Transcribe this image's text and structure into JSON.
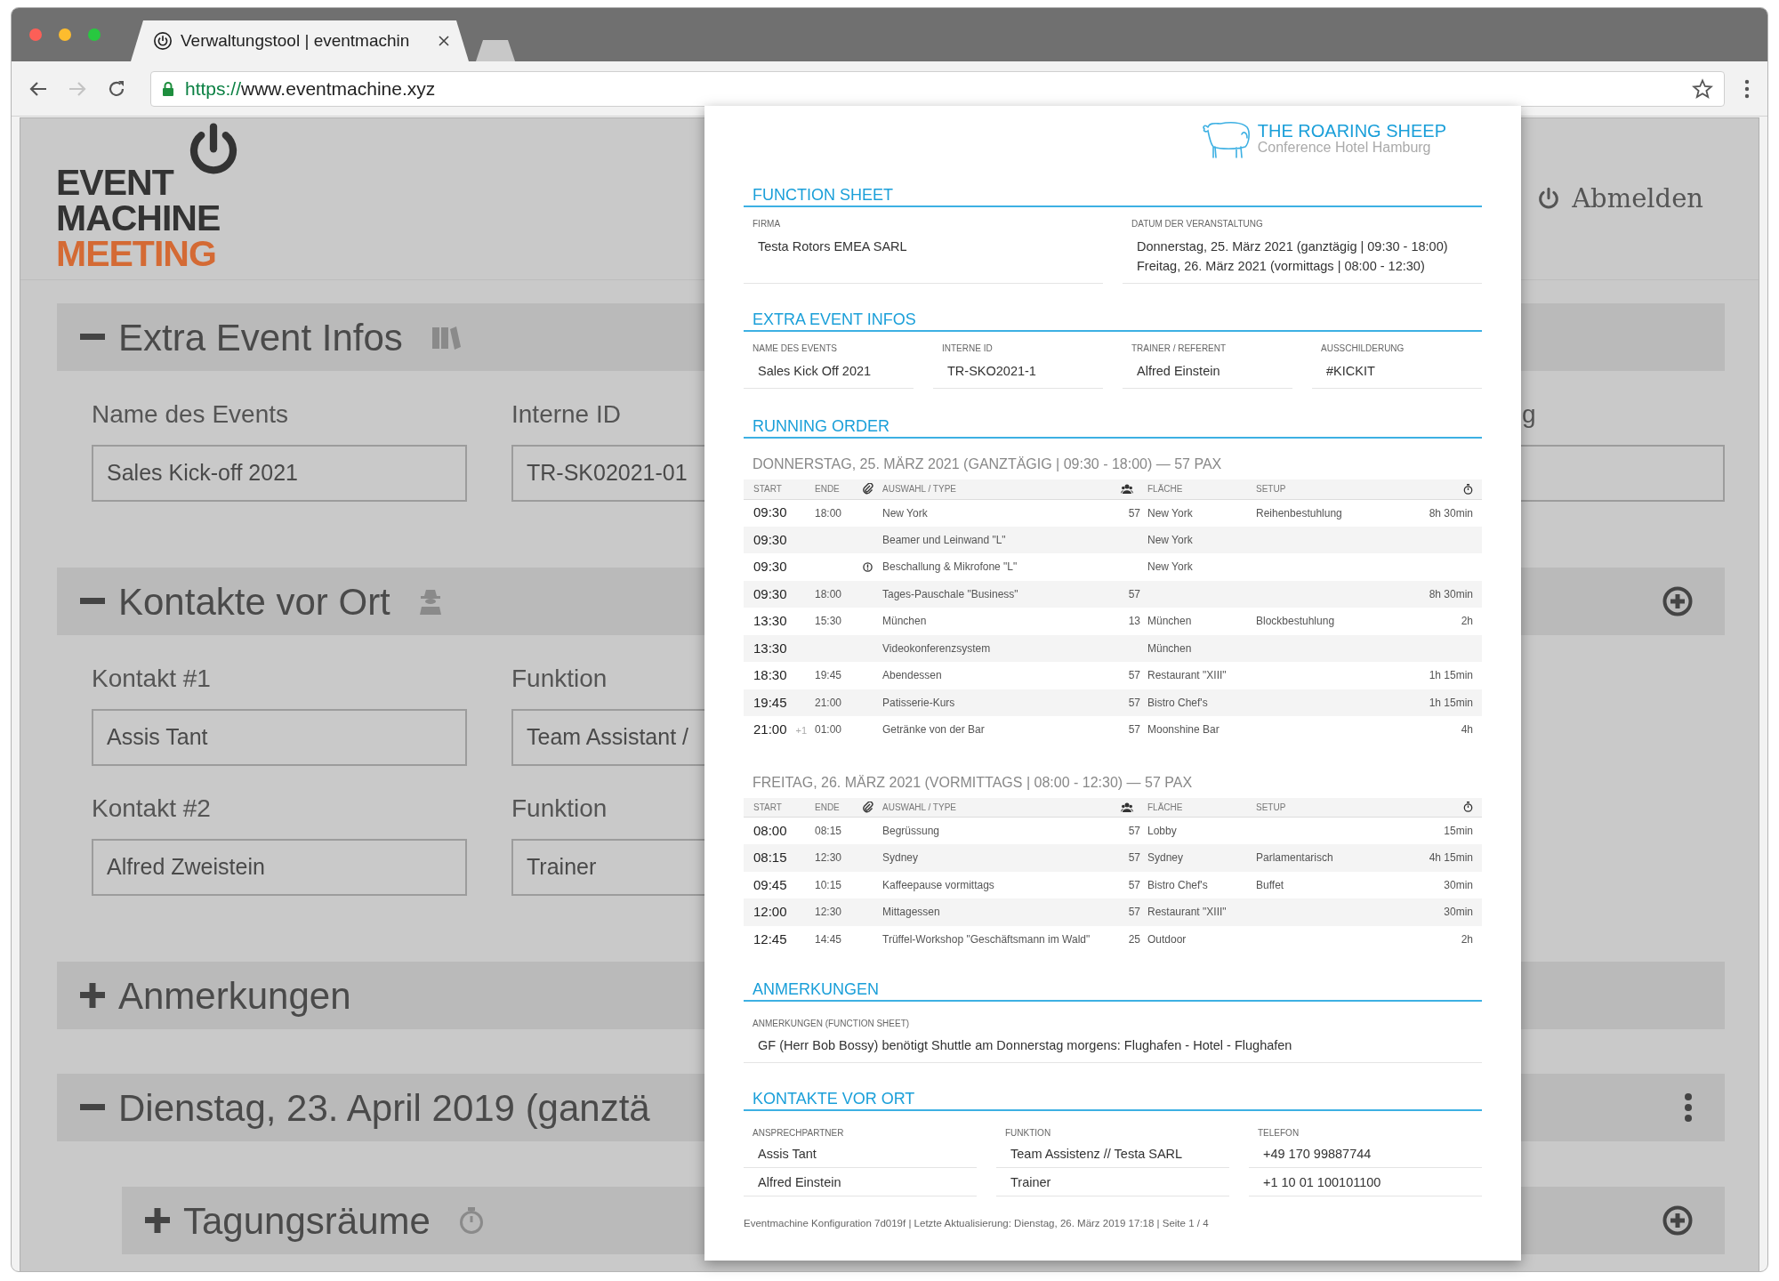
{
  "browser": {
    "tab_title": "Verwaltungstool | eventmachin",
    "url_scheme": "https://",
    "url_host": "www.eventmachine.xyz",
    "forward_disabled": true
  },
  "app": {
    "logo": [
      "EVENT",
      "MACHINE",
      "MEETING"
    ],
    "logout": "Abmelden",
    "sections": [
      {
        "title": "Extra Event Infos",
        "kind": "plain",
        "expanded": true,
        "rows": [
          [
            {
              "label": "Name des Events",
              "value": "Sales Kick-off 2021"
            },
            {
              "label": "Interne ID",
              "value": "TR-SK02021-01"
            }
          ]
        ],
        "side_field": {
          "label": "g"
        }
      },
      {
        "title": "Kontakte vor Ort",
        "expanded": true,
        "kind": "add",
        "rows": [
          [
            {
              "label": "Kontakt #1",
              "value": "Assis Tant"
            },
            {
              "label": "Funktion",
              "value": "Team Assistant /"
            }
          ],
          [
            {
              "label": "Kontakt #2",
              "value": "Alfred Zweistein"
            },
            {
              "label": "Funktion",
              "value": "Trainer"
            }
          ]
        ]
      },
      {
        "title": "Anmerkungen",
        "kind": "plain",
        "expanded": false
      },
      {
        "title": "Dienstag, 23. April 2019 (ganztä",
        "expanded": true,
        "kind": "menu",
        "children": [
          {
            "title": "Tagungsräume",
            "expanded": false,
            "kind": "add"
          }
        ]
      }
    ]
  },
  "sheet": {
    "hotel_name": "THE ROARING SHEEP",
    "hotel_subtitle": "Conference Hotel Hamburg",
    "function_sheet": {
      "title": "FUNCTION SHEET",
      "fields": [
        {
          "label": "FIRMA",
          "lines": [
            "Testa Rotors EMEA SARL"
          ]
        },
        {
          "label": "DATUM DER VERANSTALTUNG",
          "lines": [
            "Donnerstag, 25. März 2021 (ganztägig | 09:30 - 18:00)",
            "Freitag, 26. März 2021 (vormittags | 08:00 - 12:30)"
          ]
        }
      ]
    },
    "extra_event_infos": {
      "title": "EXTRA EVENT INFOS",
      "fields": [
        {
          "label": "NAME DES EVENTS",
          "lines": [
            "Sales Kick Off 2021"
          ]
        },
        {
          "label": "INTERNE ID",
          "lines": [
            "TR-SKO2021-1"
          ]
        },
        {
          "label": "TRAINER / REFERENT",
          "lines": [
            "Alfred Einstein"
          ]
        },
        {
          "label": "AUSSCHILDERUNG",
          "lines": [
            "#KICKIT"
          ]
        }
      ]
    },
    "running_order": {
      "title": "RUNNING ORDER",
      "days": [
        {
          "heading": "DONNERSTAG, 25. MÄRZ 2021 (GANZTÄGIG | 09:30 - 18:00) — 57 PAX",
          "columns": [
            "START",
            "ENDE",
            "AUSWAHL / TYPE",
            "FLÄCHE",
            "SETUP"
          ],
          "rows": [
            {
              "start": "09:30",
              "end": "18:00",
              "has_note": false,
              "type": "New York",
              "pax": "57",
              "area": "New York",
              "setup": "Reihenbestuhlung",
              "duration": "8h 30min"
            },
            {
              "start": "09:30",
              "has_note": false,
              "type": "Beamer und Leinwand \"L\"",
              "area": "New York"
            },
            {
              "start": "09:30",
              "has_note": true,
              "type": "Beschallung & Mikrofone \"L\"",
              "area": "New York"
            },
            {
              "start": "09:30",
              "end": "18:00",
              "has_note": false,
              "type": "Tages-Pauschale \"Business\"",
              "pax": "57",
              "duration": "8h 30min"
            },
            {
              "start": "13:30",
              "end": "15:30",
              "has_note": false,
              "type": "München",
              "pax": "13",
              "area": "München",
              "setup": "Blockbestuhlung",
              "duration": "2h"
            },
            {
              "start": "13:30",
              "has_note": false,
              "type": "Videokonferenzsystem",
              "area": "München"
            },
            {
              "start": "18:30",
              "end": "19:45",
              "has_note": false,
              "type": "Abendessen",
              "pax": "57",
              "area": "Restaurant \"XIII\"",
              "duration": "1h 15min"
            },
            {
              "start": "19:45",
              "end": "21:00",
              "has_note": false,
              "type": "Patisserie-Kurs",
              "pax": "57",
              "area": "Bistro Chef's",
              "duration": "1h 15min"
            },
            {
              "start": "21:00",
              "next_day": "+1",
              "end": "01:00",
              "has_note": false,
              "type": "Getränke von der Bar",
              "pax": "57",
              "area": "Moonshine Bar",
              "duration": "4h"
            }
          ]
        },
        {
          "heading": "FREITAG, 26. MÄRZ 2021 (VORMITTAGS | 08:00 - 12:30) — 57 PAX",
          "columns": [
            "START",
            "ENDE",
            "AUSWAHL / TYPE",
            "FLÄCHE",
            "SETUP"
          ],
          "rows": [
            {
              "start": "08:00",
              "end": "08:15",
              "has_note": false,
              "type": "Begrüssung",
              "pax": "57",
              "area": "Lobby",
              "duration": "15min"
            },
            {
              "start": "08:15",
              "end": "12:30",
              "has_note": false,
              "type": "Sydney",
              "pax": "57",
              "area": "Sydney",
              "setup": "Parlamentarisch",
              "duration": "4h 15min"
            },
            {
              "start": "09:45",
              "end": "10:15",
              "has_note": false,
              "type": "Kaffeepause vormittags",
              "pax": "57",
              "area": "Bistro Chef's",
              "setup": "Buffet",
              "duration": "30min"
            },
            {
              "start": "12:00",
              "end": "12:30",
              "has_note": false,
              "type": "Mittagessen",
              "pax": "57",
              "area": "Restaurant \"XIII\"",
              "duration": "30min"
            },
            {
              "start": "12:45",
              "end": "14:45",
              "has_note": false,
              "type": "Trüffel-Workshop \"Geschäftsmann im Wald\"",
              "pax": "25",
              "area": "Outdoor",
              "duration": "2h"
            }
          ]
        }
      ]
    },
    "notes": {
      "title": "ANMERKUNGEN",
      "label": "ANMERKUNGEN (FUNCTION SHEET)",
      "text": "GF (Herr Bob Bossy) benötigt Shuttle am Donnerstag morgens: Flughafen - Hotel - Flughafen"
    },
    "contacts": {
      "title": "KONTAKTE VOR ORT",
      "columns": [
        "ANSPRECHPARTNER",
        "FUNKTION",
        "TELEFON"
      ],
      "rows": [
        [
          "Assis Tant",
          "Team Assistenz // Testa SARL",
          "+49 170 99887744"
        ],
        [
          "Alfred Einstein",
          "Trainer",
          "+1 10 01 100101100"
        ]
      ]
    },
    "footer": "Eventmachine Konfiguration 7d019f | Letzte Aktualisierung: Dienstag, 26. März 2019 17:18 | Seite 1 / 4"
  }
}
